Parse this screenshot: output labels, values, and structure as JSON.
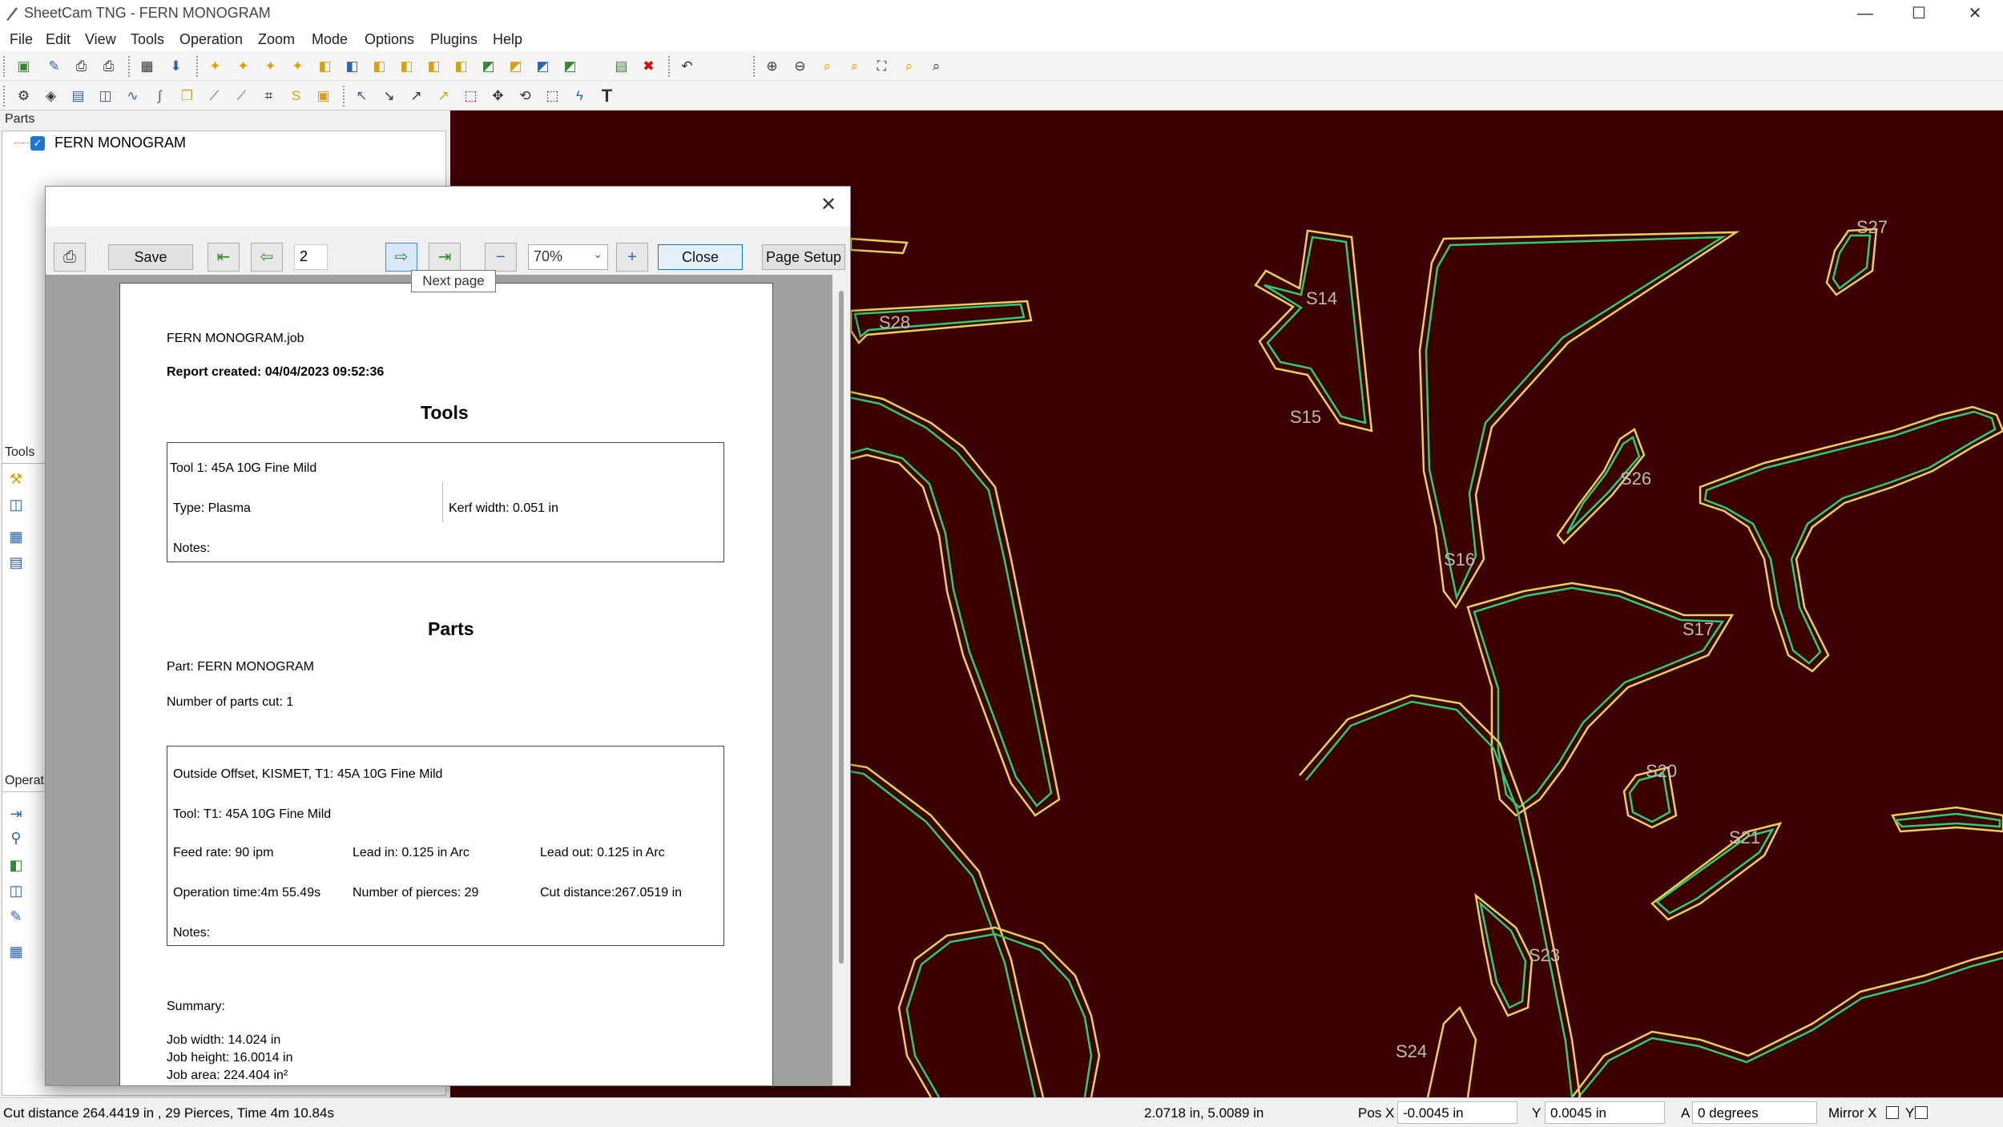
{
  "window": {
    "title": "SheetCam TNG - FERN MONOGRAM",
    "minimize": "—",
    "maximize": "☐",
    "close": "✕"
  },
  "menu": [
    "File",
    "Edit",
    "View",
    "Tools",
    "Operation",
    "Zoom",
    "Mode",
    "Options",
    "Plugins",
    "Help"
  ],
  "toolbar1_icons": [
    "new-part",
    "edit-part",
    "print",
    "print-report",
    "calculator",
    "post-process",
    "add-part-1",
    "add-part-2",
    "add-part-3",
    "add-part-4",
    "add-part-5",
    "add-part-6",
    "add-part-7",
    "add-part-8",
    "add-part-9",
    "add-part-10",
    "add-part-11",
    "add-part-12",
    "add-part-13",
    "add-part-14",
    "delete",
    "undo",
    "zoom-in",
    "zoom-out",
    "zoom-window",
    "zoom-all",
    "zoom-fit",
    "zoom-selected"
  ],
  "toolbar2_icons": [
    "tools",
    "layers",
    "table",
    "boxes",
    "path",
    "curve",
    "copy",
    "measure",
    "draw",
    "grid",
    "snap",
    "highlight",
    "select",
    "select-shape",
    "select-node",
    "select-multi",
    "select-box",
    "move",
    "rotate",
    "crop",
    "bolt",
    "text"
  ],
  "panels": {
    "parts_header": "Parts",
    "tools_header": "Tools",
    "operations_header": "Operati"
  },
  "parts_tree": [
    {
      "label": "FERN MONOGRAM",
      "checked": true
    }
  ],
  "dialog": {
    "save": "Save",
    "page": "2",
    "zoom": "70%",
    "close": "Close",
    "page_setup": "Page Setup",
    "tooltip": "Next page",
    "report": {
      "filename": "FERN MONOGRAM.job",
      "created": "Report created: 04/04/2023 09:52:36",
      "tools_heading": "Tools",
      "tool_name": "Tool 1: 45A 10G Fine Mild",
      "tool_type": "Type: Plasma",
      "tool_kerf": "Kerf width: 0.051 in",
      "tool_notes": "Notes:",
      "parts_heading": "Parts",
      "part_name": "Part: FERN MONOGRAM",
      "parts_cut": "Number of parts cut: 1",
      "op_title": "Outside Offset, KISMET, T1: 45A 10G Fine Mild",
      "op_tool": "Tool: T1: 45A 10G Fine Mild",
      "op_feed": "Feed rate: 90 ipm",
      "op_leadin": "Lead in: 0.125 in Arc",
      "op_leadout": "Lead out: 0.125 in Arc",
      "op_time": "Operation time:4m 55.49s",
      "op_pierces": "Number of pierces: 29",
      "op_cut": "Cut distance:267.0519 in",
      "op_notes": "Notes:",
      "summary": "Summary:",
      "job_width": "Job width: 14.024 in",
      "job_height": "Job height: 16.0014 in",
      "job_area": "Job area: 224.404 in²"
    }
  },
  "canvas_labels": [
    "S27",
    "S14",
    "S28",
    "S15",
    "S26",
    "S16",
    "S17",
    "S20",
    "S21",
    "S23",
    "S24"
  ],
  "status": {
    "cut": "Cut distance 264.4419 in , 29 Pierces, Time 4m 10.84s",
    "coords": "2.0718 in, 5.0089 in",
    "posx_label": "Pos X",
    "posx": "-0.0045 in",
    "y_label": "Y",
    "y": "0.0045 in",
    "a_label": "A",
    "a": "0 degrees",
    "mirror": "Mirror X",
    "mirror_y": "Y"
  },
  "colors": {
    "canvas_bg": "#3d0000",
    "path_yellow": "#e6d25a",
    "path_green": "#2ecc71"
  }
}
